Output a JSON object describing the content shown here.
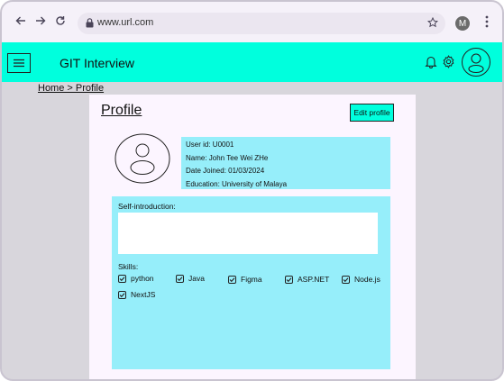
{
  "browser": {
    "url": "www.url.com",
    "account_initial": "M"
  },
  "app": {
    "title": "GIT Interview"
  },
  "breadcrumb": "Home > Profile",
  "profile": {
    "title": "Profile",
    "edit_label": "Edit profile",
    "user_id": "User id: U0001",
    "name": "Name: John Tee Wei ZHe",
    "date_joined": "Date Joined: 01/03/2024",
    "education": "Education: University of Malaya",
    "self_intro_label": "Self-introduction:",
    "self_intro_value": "",
    "skills_label": "Skills:",
    "skills": [
      "python",
      "Java",
      "Figma",
      "ASP.NET",
      "Node.js",
      "NextJS"
    ]
  },
  "colors": {
    "accent": "#00ffdd",
    "panel": "#96eefa",
    "card": "#fcf5ff",
    "chrome": "#f5f1f9"
  },
  "icons": {
    "back": "arrow-left-icon",
    "forward": "arrow-right-icon",
    "reload": "reload-icon",
    "lock": "lock-icon",
    "star": "star-icon",
    "menu": "hamburger-icon",
    "bell": "bell-icon",
    "gear": "gear-icon",
    "user": "user-icon"
  }
}
